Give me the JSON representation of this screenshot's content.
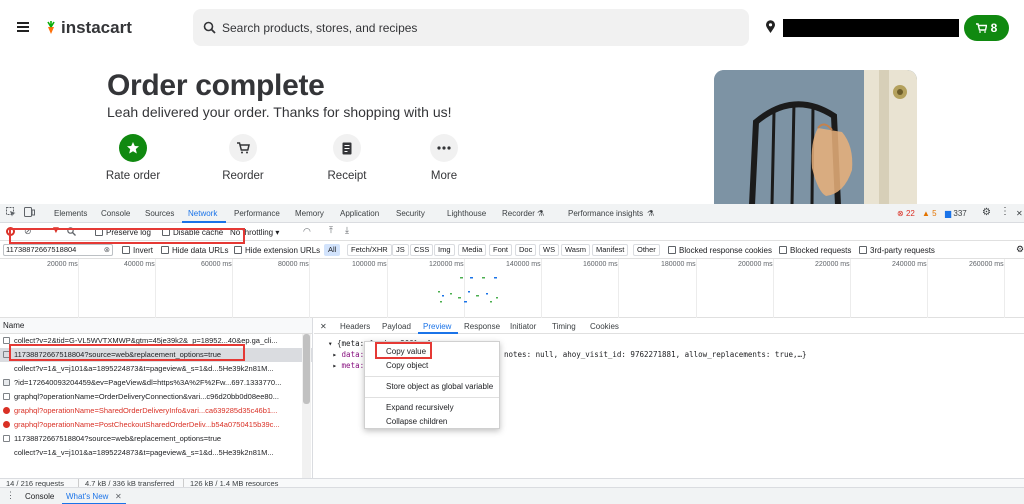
{
  "header": {
    "logo": "instacart",
    "search_placeholder": "Search products, stores, and recipes",
    "cart_count": "8"
  },
  "order": {
    "title": "Order complete",
    "subtitle": "Leah delivered your order. Thanks for shopping with us!",
    "actions": [
      {
        "label": "Rate order",
        "icon": "star-icon"
      },
      {
        "label": "Reorder",
        "icon": "cart-icon"
      },
      {
        "label": "Receipt",
        "icon": "receipt-icon"
      },
      {
        "label": "More",
        "icon": "more-icon"
      }
    ]
  },
  "devtools": {
    "tabs": [
      "Elements",
      "Console",
      "Sources",
      "Network",
      "Performance",
      "Memory",
      "Application",
      "Security",
      "Lighthouse",
      "Recorder",
      "Performance insights"
    ],
    "active_tab": "Network",
    "errors": "22",
    "warnings": "5",
    "issues": "337",
    "toolbar": {
      "preserve_log": "Preserve log",
      "disable_cache": "Disable cache",
      "throttling": "No throttling"
    },
    "filter": {
      "value": "11738872667518804",
      "invert": "Invert",
      "hide_data_urls": "Hide data URLs",
      "hide_ext_urls": "Hide extension URLs",
      "types": [
        "All",
        "Fetch/XHR",
        "JS",
        "CSS",
        "Img",
        "Media",
        "Font",
        "Doc",
        "WS",
        "Wasm",
        "Manifest",
        "Other"
      ],
      "blocked_cookies": "Blocked response cookies",
      "blocked_requests": "Blocked requests",
      "third_party": "3rd-party requests"
    },
    "timeline_ticks": [
      "20000 ms",
      "40000 ms",
      "60000 ms",
      "80000 ms",
      "100000 ms",
      "120000 ms",
      "140000 ms",
      "160000 ms",
      "180000 ms",
      "200000 ms",
      "220000 ms",
      "240000 ms",
      "260000 ms"
    ],
    "requests_header": "Name",
    "requests": [
      {
        "name": "collect?v=2&tid=G-VL5WVTXMWP&gtm=45je39k2&_p=18952...40&ep.ga_cli...",
        "state": "normal"
      },
      {
        "name": "11738872667518804?source=web&replacement_options=true",
        "state": "selected"
      },
      {
        "name": "collect?v=1&_v=j101&a=1895224873&t=pageview&_s=1&d...5He39k2n81M...",
        "state": "normal"
      },
      {
        "name": "?id=172640093204459&ev=PageView&dl=https%3A%2F%2Fw...697.1333770...",
        "state": "normal"
      },
      {
        "name": "graphql?operationName=OrderDeliveryConnection&vari...c96d20bb0d08ee80...",
        "state": "normal"
      },
      {
        "name": "graphql?operationName=SharedOrderDeliveryInfo&vari...ca639285d35c46b1...",
        "state": "error"
      },
      {
        "name": "graphql?operationName=PostCheckoutSharedOrderDeliv...b54a0750415b39c...",
        "state": "error"
      },
      {
        "name": "11738872667518804?source=web&replacement_options=true",
        "state": "normal"
      },
      {
        "name": "collect?v=1&_v=j101&a=1895224873&t=pageview&_s=1&d...5He39k2n81M...",
        "state": "normal"
      }
    ],
    "detail_tabs": [
      "Headers",
      "Payload",
      "Preview",
      "Response",
      "Initiator",
      "Timing",
      "Cookies"
    ],
    "active_detail_tab": "Preview",
    "preview": {
      "root": "{meta: {code: 200},…}",
      "data_key": "data:",
      "data_val": "notes: null, ahoy_visit_id: 9762271881, allow_replacements: true,…}",
      "meta_key": "meta:"
    },
    "context_menu": [
      "Copy value",
      "Copy object",
      "Store object as global variable",
      "Expand recursively",
      "Collapse children"
    ],
    "status": {
      "requests": "14 / 216 requests",
      "transferred": "4.7 kB / 336 kB transferred",
      "resources": "126 kB / 1.4 MB resources"
    },
    "drawer_tabs": [
      "Console",
      "What's New"
    ]
  }
}
